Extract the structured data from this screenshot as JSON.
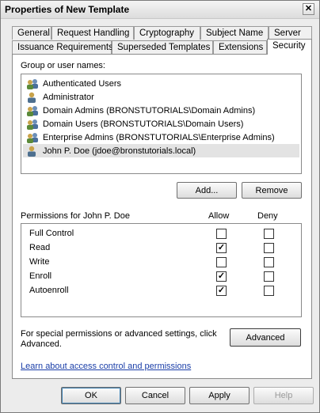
{
  "window": {
    "title": "Properties of New Template",
    "close_glyph": "✕"
  },
  "tabs_row1": [
    {
      "label": "General"
    },
    {
      "label": "Request Handling"
    },
    {
      "label": "Cryptography"
    },
    {
      "label": "Subject Name"
    },
    {
      "label": "Server"
    }
  ],
  "tabs_row2": [
    {
      "label": "Issuance Requirements"
    },
    {
      "label": "Superseded Templates"
    },
    {
      "label": "Extensions"
    },
    {
      "label": "Security",
      "active": true
    }
  ],
  "groups": {
    "label": "Group or user names:",
    "items": [
      {
        "name": "Authenticated Users",
        "icon": "user-group-icon"
      },
      {
        "name": "Administrator",
        "icon": "user-icon"
      },
      {
        "name": "Domain Admins (BRONSTUTORIALS\\Domain Admins)",
        "icon": "user-group-icon"
      },
      {
        "name": "Domain Users (BRONSTUTORIALS\\Domain Users)",
        "icon": "user-group-icon"
      },
      {
        "name": "Enterprise Admins (BRONSTUTORIALS\\Enterprise Admins)",
        "icon": "user-group-icon"
      },
      {
        "name": "John P. Doe (jdoe@bronstutorials.local)",
        "icon": "user-icon",
        "selected": true
      }
    ],
    "add_label": "Add...",
    "remove_label": "Remove"
  },
  "permissions": {
    "label": "Permissions for John P. Doe",
    "allow_header": "Allow",
    "deny_header": "Deny",
    "rows": [
      {
        "name": "Full Control",
        "allow": false,
        "deny": false
      },
      {
        "name": "Read",
        "allow": true,
        "deny": false
      },
      {
        "name": "Write",
        "allow": false,
        "deny": false
      },
      {
        "name": "Enroll",
        "allow": true,
        "deny": false
      },
      {
        "name": "Autoenroll",
        "allow": true,
        "deny": false
      }
    ],
    "check_glyph": "✓"
  },
  "advanced": {
    "text_line1": "For special permissions or advanced settings, click",
    "text_line2": "Advanced.",
    "button_label": "Advanced"
  },
  "link_text": "Learn about access control and permissions",
  "footer": {
    "ok": "OK",
    "cancel": "Cancel",
    "apply": "Apply",
    "help": "Help"
  }
}
